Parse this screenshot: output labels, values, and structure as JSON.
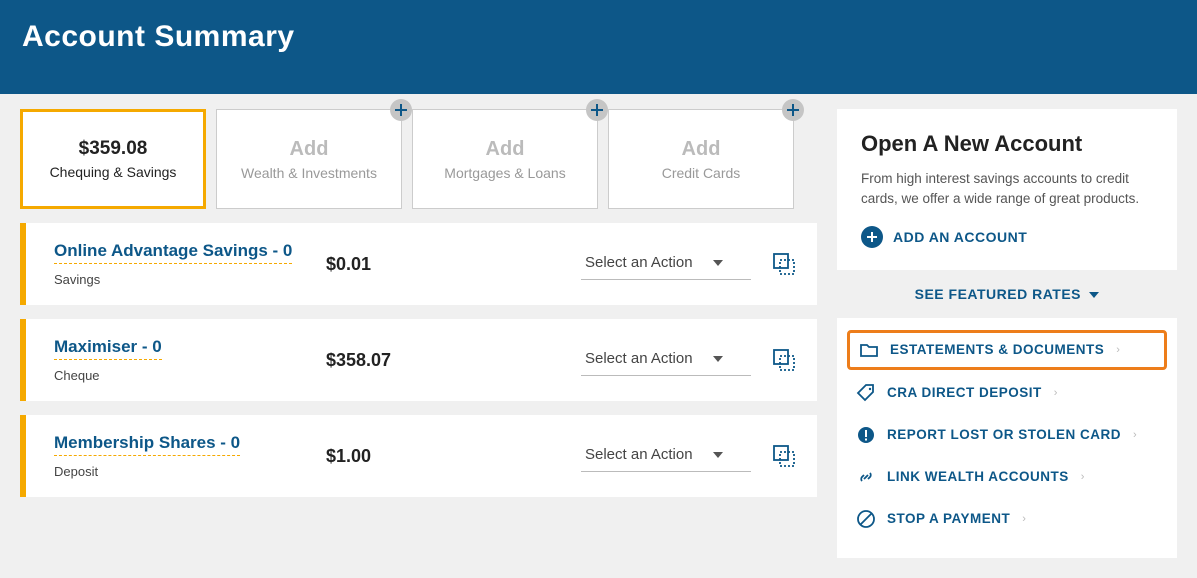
{
  "page_title": "Account Summary",
  "tabs": [
    {
      "amount": "$359.08",
      "label": "Chequing & Savings",
      "active": true,
      "add": false
    },
    {
      "amount": "Add",
      "label": "Wealth & Investments",
      "active": false,
      "add": true
    },
    {
      "amount": "Add",
      "label": "Mortgages & Loans",
      "active": false,
      "add": true
    },
    {
      "amount": "Add",
      "label": "Credit Cards",
      "active": false,
      "add": true
    }
  ],
  "accounts": [
    {
      "name": "Online Advantage Savings - 0",
      "type": "Savings",
      "balance": "$0.01",
      "action_placeholder": "Select an Action"
    },
    {
      "name": "Maximiser - 0",
      "type": "Cheque",
      "balance": "$358.07",
      "action_placeholder": "Select an Action"
    },
    {
      "name": "Membership Shares - 0",
      "type": "Deposit",
      "balance": "$1.00",
      "action_placeholder": "Select an Action"
    }
  ],
  "open_account": {
    "title": "Open A New Account",
    "desc": "From high interest savings accounts to credit cards, we offer a wide range of great products.",
    "add_label": "ADD AN ACCOUNT"
  },
  "featured_rates_label": "SEE FEATURED RATES",
  "quick_links": [
    {
      "label": "ESTATEMENTS & DOCUMENTS",
      "icon": "folder",
      "highlight": true
    },
    {
      "label": "CRA DIRECT DEPOSIT",
      "icon": "tag",
      "highlight": false
    },
    {
      "label": "REPORT LOST OR STOLEN CARD",
      "icon": "alert",
      "highlight": false
    },
    {
      "label": "LINK WEALTH ACCOUNTS",
      "icon": "link",
      "highlight": false
    },
    {
      "label": "STOP A PAYMENT",
      "icon": "stop",
      "highlight": false
    }
  ]
}
